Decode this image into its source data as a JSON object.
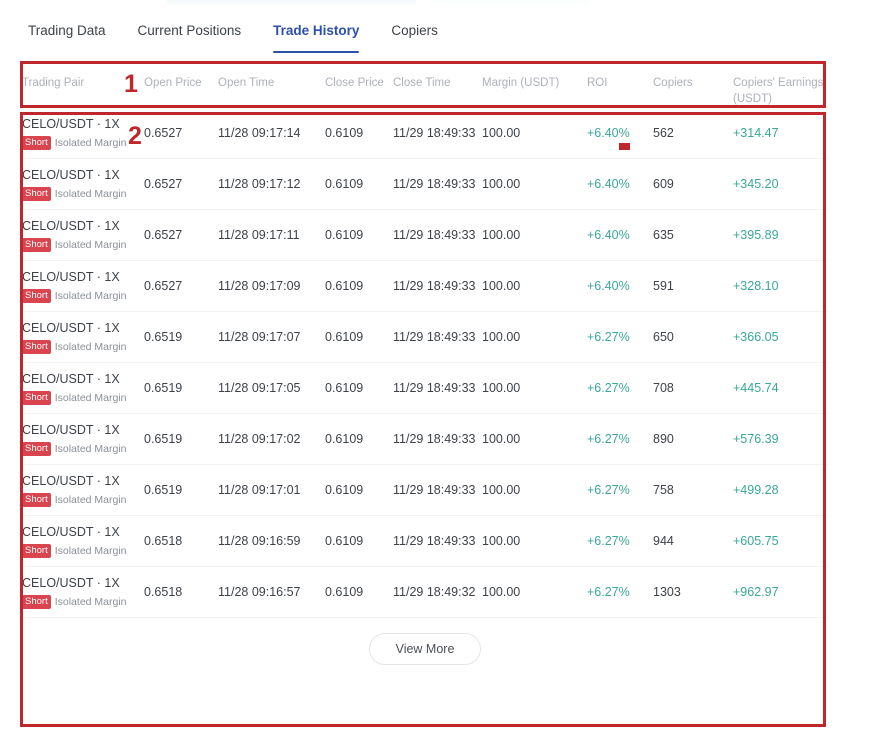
{
  "tabs": [
    {
      "label": "Trading Data",
      "active": false
    },
    {
      "label": "Current Positions",
      "active": false
    },
    {
      "label": "Trade History",
      "active": true
    },
    {
      "label": "Copiers",
      "active": false
    }
  ],
  "table": {
    "columns": [
      "Trading Pair",
      "Open Price",
      "Open Time",
      "Close Price",
      "Close Time",
      "Margin (USDT)",
      "ROI",
      "Copiers",
      "Copiers' Earnings (USDT)"
    ],
    "rows": [
      {
        "pair": "CELO/USDT · 1X",
        "side": "Short",
        "margin_mode": "Isolated Margin",
        "open_price": "0.6527",
        "open_time": "11/28 09:17:14",
        "close_price": "0.6109",
        "close_time": "11/29 18:49:33",
        "margin": "100.00",
        "roi": "+6.40%",
        "copiers": "562",
        "earnings": "+314.47"
      },
      {
        "pair": "CELO/USDT · 1X",
        "side": "Short",
        "margin_mode": "Isolated Margin",
        "open_price": "0.6527",
        "open_time": "11/28 09:17:12",
        "close_price": "0.6109",
        "close_time": "11/29 18:49:33",
        "margin": "100.00",
        "roi": "+6.40%",
        "copiers": "609",
        "earnings": "+345.20"
      },
      {
        "pair": "CELO/USDT · 1X",
        "side": "Short",
        "margin_mode": "Isolated Margin",
        "open_price": "0.6527",
        "open_time": "11/28 09:17:11",
        "close_price": "0.6109",
        "close_time": "11/29 18:49:33",
        "margin": "100.00",
        "roi": "+6.40%",
        "copiers": "635",
        "earnings": "+395.89"
      },
      {
        "pair": "CELO/USDT · 1X",
        "side": "Short",
        "margin_mode": "Isolated Margin",
        "open_price": "0.6527",
        "open_time": "11/28 09:17:09",
        "close_price": "0.6109",
        "close_time": "11/29 18:49:33",
        "margin": "100.00",
        "roi": "+6.40%",
        "copiers": "591",
        "earnings": "+328.10"
      },
      {
        "pair": "CELO/USDT · 1X",
        "side": "Short",
        "margin_mode": "Isolated Margin",
        "open_price": "0.6519",
        "open_time": "11/28 09:17:07",
        "close_price": "0.6109",
        "close_time": "11/29 18:49:33",
        "margin": "100.00",
        "roi": "+6.27%",
        "copiers": "650",
        "earnings": "+366.05"
      },
      {
        "pair": "CELO/USDT · 1X",
        "side": "Short",
        "margin_mode": "Isolated Margin",
        "open_price": "0.6519",
        "open_time": "11/28 09:17:05",
        "close_price": "0.6109",
        "close_time": "11/29 18:49:33",
        "margin": "100.00",
        "roi": "+6.27%",
        "copiers": "708",
        "earnings": "+445.74"
      },
      {
        "pair": "CELO/USDT · 1X",
        "side": "Short",
        "margin_mode": "Isolated Margin",
        "open_price": "0.6519",
        "open_time": "11/28 09:17:02",
        "close_price": "0.6109",
        "close_time": "11/29 18:49:33",
        "margin": "100.00",
        "roi": "+6.27%",
        "copiers": "890",
        "earnings": "+576.39"
      },
      {
        "pair": "CELO/USDT · 1X",
        "side": "Short",
        "margin_mode": "Isolated Margin",
        "open_price": "0.6519",
        "open_time": "11/28 09:17:01",
        "close_price": "0.6109",
        "close_time": "11/29 18:49:33",
        "margin": "100.00",
        "roi": "+6.27%",
        "copiers": "758",
        "earnings": "+499.28"
      },
      {
        "pair": "CELO/USDT · 1X",
        "side": "Short",
        "margin_mode": "Isolated Margin",
        "open_price": "0.6518",
        "open_time": "11/28 09:16:59",
        "close_price": "0.6109",
        "close_time": "11/29 18:49:33",
        "margin": "100.00",
        "roi": "+6.27%",
        "copiers": "944",
        "earnings": "+605.75"
      },
      {
        "pair": "CELO/USDT · 1X",
        "side": "Short",
        "margin_mode": "Isolated Margin",
        "open_price": "0.6518",
        "open_time": "11/28 09:16:57",
        "close_price": "0.6109",
        "close_time": "11/29 18:49:32",
        "margin": "100.00",
        "roi": "+6.27%",
        "copiers": "1303",
        "earnings": "+962.97"
      }
    ]
  },
  "footer": {
    "view_more_label": "View More"
  },
  "annotations": {
    "marker_1": "1",
    "marker_2": "2"
  },
  "colors": {
    "accent_tab": "#2b50aa",
    "profit_green": "#3aa79a",
    "short_badge_red": "#d9444f",
    "annotation_red": "#c0272d"
  }
}
